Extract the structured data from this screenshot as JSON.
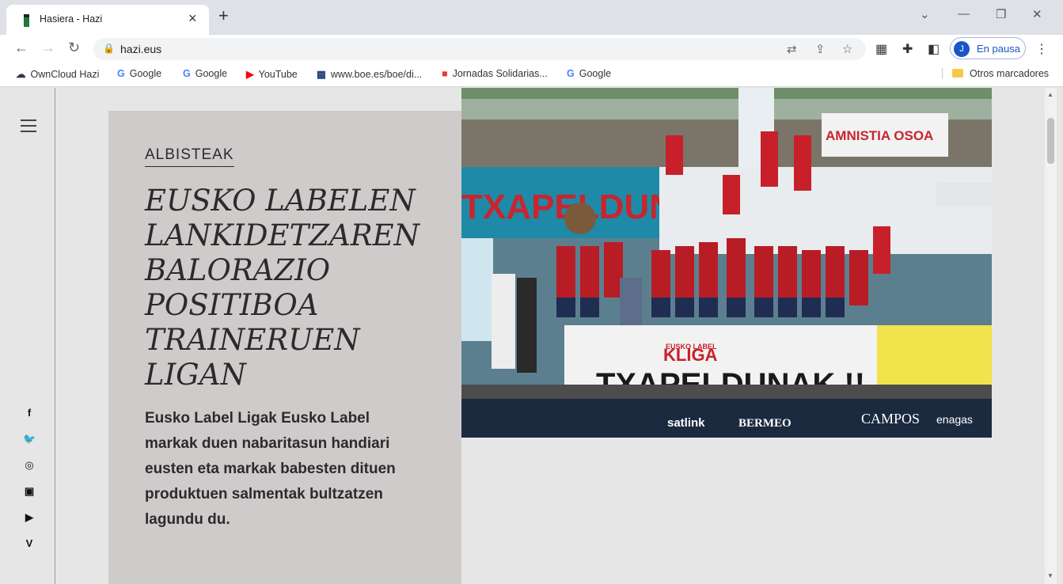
{
  "browser": {
    "tab_title": "Hasiera - Hazi",
    "tab_close": "×",
    "new_tab": "+",
    "url": "hazi.eus",
    "profile_initial": "J",
    "profile_label": "En pausa",
    "window_controls": {
      "menu": "⌄",
      "minimize": "—",
      "restore": "❐",
      "close": "✕"
    }
  },
  "bookmarks": [
    {
      "label": "OwnCloud Hazi",
      "icon": "cloud-icon",
      "color": "#2b3a4a"
    },
    {
      "label": "Google",
      "icon": "google-icon",
      "color": "#4285f4"
    },
    {
      "label": "Google",
      "icon": "google-icon",
      "color": "#4285f4"
    },
    {
      "label": "YouTube",
      "icon": "youtube-icon",
      "color": "#ff0000"
    },
    {
      "label": "www.boe.es/boe/di...",
      "icon": "boe-icon",
      "color": "#1c3b7a"
    },
    {
      "label": "Jornadas Solidarias...",
      "icon": "jornadas-icon",
      "color": "#e53935"
    },
    {
      "label": "Google",
      "icon": "google-icon",
      "color": "#4285f4"
    }
  ],
  "other_bookmarks": "Otros marcadores",
  "article": {
    "kicker": "ALBISTEAK",
    "headline": "EUSKO LABELEN LANKIDETZAREN BALORAZIO POSITIBOA TRAINERUEN LIGAN",
    "lead": "Eusko Label Ligak Eusko Label markak duen nabaritasun handiari eusten eta markak babesten dituen produktuen salmentak bultzatzen lagundu du."
  },
  "photo": {
    "banner_text": "TXAPELDUNAK",
    "front_banner": "TXAPELDUNAK !!",
    "sign_text": "AMNISTIA OSOA",
    "league_logo": "KLIGA",
    "league_logo_top": "EUSKO LABEL",
    "sponsors": [
      "satlink",
      "BERMEO",
      "CAMPOS",
      "enagas"
    ]
  },
  "social": [
    "facebook-icon",
    "twitter-icon",
    "instagram-icon",
    "flickr-icon",
    "youtube-icon",
    "vimeo-icon"
  ]
}
